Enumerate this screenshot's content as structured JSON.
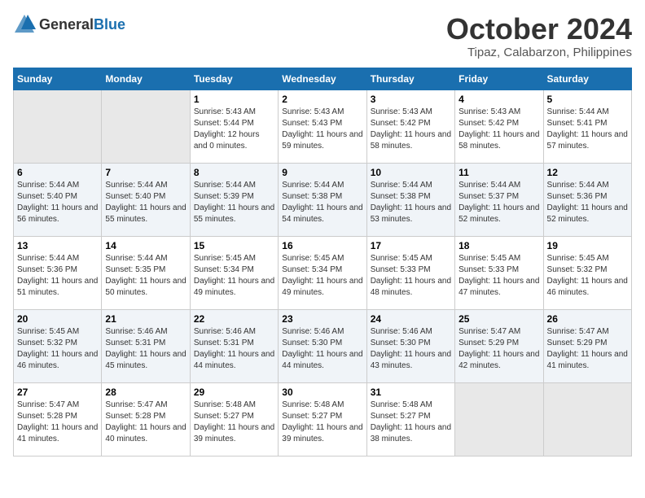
{
  "header": {
    "logo_general": "General",
    "logo_blue": "Blue",
    "month": "October 2024",
    "location": "Tipaz, Calabarzon, Philippines"
  },
  "weekdays": [
    "Sunday",
    "Monday",
    "Tuesday",
    "Wednesday",
    "Thursday",
    "Friday",
    "Saturday"
  ],
  "weeks": [
    [
      {
        "day": "",
        "sunrise": "",
        "sunset": "",
        "daylight": "",
        "empty": true
      },
      {
        "day": "",
        "sunrise": "",
        "sunset": "",
        "daylight": "",
        "empty": true
      },
      {
        "day": "1",
        "sunrise": "Sunrise: 5:43 AM",
        "sunset": "Sunset: 5:44 PM",
        "daylight": "Daylight: 12 hours and 0 minutes."
      },
      {
        "day": "2",
        "sunrise": "Sunrise: 5:43 AM",
        "sunset": "Sunset: 5:43 PM",
        "daylight": "Daylight: 11 hours and 59 minutes."
      },
      {
        "day": "3",
        "sunrise": "Sunrise: 5:43 AM",
        "sunset": "Sunset: 5:42 PM",
        "daylight": "Daylight: 11 hours and 58 minutes."
      },
      {
        "day": "4",
        "sunrise": "Sunrise: 5:43 AM",
        "sunset": "Sunset: 5:42 PM",
        "daylight": "Daylight: 11 hours and 58 minutes."
      },
      {
        "day": "5",
        "sunrise": "Sunrise: 5:44 AM",
        "sunset": "Sunset: 5:41 PM",
        "daylight": "Daylight: 11 hours and 57 minutes."
      }
    ],
    [
      {
        "day": "6",
        "sunrise": "Sunrise: 5:44 AM",
        "sunset": "Sunset: 5:40 PM",
        "daylight": "Daylight: 11 hours and 56 minutes."
      },
      {
        "day": "7",
        "sunrise": "Sunrise: 5:44 AM",
        "sunset": "Sunset: 5:40 PM",
        "daylight": "Daylight: 11 hours and 55 minutes."
      },
      {
        "day": "8",
        "sunrise": "Sunrise: 5:44 AM",
        "sunset": "Sunset: 5:39 PM",
        "daylight": "Daylight: 11 hours and 55 minutes."
      },
      {
        "day": "9",
        "sunrise": "Sunrise: 5:44 AM",
        "sunset": "Sunset: 5:38 PM",
        "daylight": "Daylight: 11 hours and 54 minutes."
      },
      {
        "day": "10",
        "sunrise": "Sunrise: 5:44 AM",
        "sunset": "Sunset: 5:38 PM",
        "daylight": "Daylight: 11 hours and 53 minutes."
      },
      {
        "day": "11",
        "sunrise": "Sunrise: 5:44 AM",
        "sunset": "Sunset: 5:37 PM",
        "daylight": "Daylight: 11 hours and 52 minutes."
      },
      {
        "day": "12",
        "sunrise": "Sunrise: 5:44 AM",
        "sunset": "Sunset: 5:36 PM",
        "daylight": "Daylight: 11 hours and 52 minutes."
      }
    ],
    [
      {
        "day": "13",
        "sunrise": "Sunrise: 5:44 AM",
        "sunset": "Sunset: 5:36 PM",
        "daylight": "Daylight: 11 hours and 51 minutes."
      },
      {
        "day": "14",
        "sunrise": "Sunrise: 5:44 AM",
        "sunset": "Sunset: 5:35 PM",
        "daylight": "Daylight: 11 hours and 50 minutes."
      },
      {
        "day": "15",
        "sunrise": "Sunrise: 5:45 AM",
        "sunset": "Sunset: 5:34 PM",
        "daylight": "Daylight: 11 hours and 49 minutes."
      },
      {
        "day": "16",
        "sunrise": "Sunrise: 5:45 AM",
        "sunset": "Sunset: 5:34 PM",
        "daylight": "Daylight: 11 hours and 49 minutes."
      },
      {
        "day": "17",
        "sunrise": "Sunrise: 5:45 AM",
        "sunset": "Sunset: 5:33 PM",
        "daylight": "Daylight: 11 hours and 48 minutes."
      },
      {
        "day": "18",
        "sunrise": "Sunrise: 5:45 AM",
        "sunset": "Sunset: 5:33 PM",
        "daylight": "Daylight: 11 hours and 47 minutes."
      },
      {
        "day": "19",
        "sunrise": "Sunrise: 5:45 AM",
        "sunset": "Sunset: 5:32 PM",
        "daylight": "Daylight: 11 hours and 46 minutes."
      }
    ],
    [
      {
        "day": "20",
        "sunrise": "Sunrise: 5:45 AM",
        "sunset": "Sunset: 5:32 PM",
        "daylight": "Daylight: 11 hours and 46 minutes."
      },
      {
        "day": "21",
        "sunrise": "Sunrise: 5:46 AM",
        "sunset": "Sunset: 5:31 PM",
        "daylight": "Daylight: 11 hours and 45 minutes."
      },
      {
        "day": "22",
        "sunrise": "Sunrise: 5:46 AM",
        "sunset": "Sunset: 5:31 PM",
        "daylight": "Daylight: 11 hours and 44 minutes."
      },
      {
        "day": "23",
        "sunrise": "Sunrise: 5:46 AM",
        "sunset": "Sunset: 5:30 PM",
        "daylight": "Daylight: 11 hours and 44 minutes."
      },
      {
        "day": "24",
        "sunrise": "Sunrise: 5:46 AM",
        "sunset": "Sunset: 5:30 PM",
        "daylight": "Daylight: 11 hours and 43 minutes."
      },
      {
        "day": "25",
        "sunrise": "Sunrise: 5:47 AM",
        "sunset": "Sunset: 5:29 PM",
        "daylight": "Daylight: 11 hours and 42 minutes."
      },
      {
        "day": "26",
        "sunrise": "Sunrise: 5:47 AM",
        "sunset": "Sunset: 5:29 PM",
        "daylight": "Daylight: 11 hours and 41 minutes."
      }
    ],
    [
      {
        "day": "27",
        "sunrise": "Sunrise: 5:47 AM",
        "sunset": "Sunset: 5:28 PM",
        "daylight": "Daylight: 11 hours and 41 minutes."
      },
      {
        "day": "28",
        "sunrise": "Sunrise: 5:47 AM",
        "sunset": "Sunset: 5:28 PM",
        "daylight": "Daylight: 11 hours and 40 minutes."
      },
      {
        "day": "29",
        "sunrise": "Sunrise: 5:48 AM",
        "sunset": "Sunset: 5:27 PM",
        "daylight": "Daylight: 11 hours and 39 minutes."
      },
      {
        "day": "30",
        "sunrise": "Sunrise: 5:48 AM",
        "sunset": "Sunset: 5:27 PM",
        "daylight": "Daylight: 11 hours and 39 minutes."
      },
      {
        "day": "31",
        "sunrise": "Sunrise: 5:48 AM",
        "sunset": "Sunset: 5:27 PM",
        "daylight": "Daylight: 11 hours and 38 minutes."
      },
      {
        "day": "",
        "sunrise": "",
        "sunset": "",
        "daylight": "",
        "empty": true
      },
      {
        "day": "",
        "sunrise": "",
        "sunset": "",
        "daylight": "",
        "empty": true
      }
    ]
  ]
}
